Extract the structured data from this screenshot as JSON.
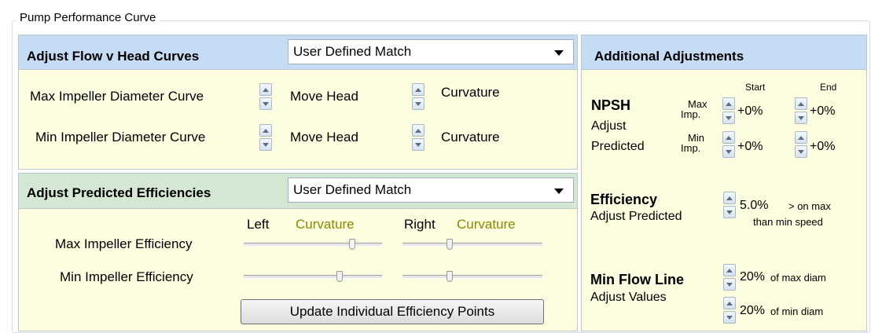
{
  "group_title": "Pump Performance Curve",
  "flow_head": {
    "title": "Adjust Flow v Head Curves",
    "mode": "User Defined Match",
    "rows": [
      {
        "label": "Max Impeller Diameter Curve",
        "move_label": "Move Head",
        "curv_label": "Curvature"
      },
      {
        "label": "Min Impeller Diameter Curve",
        "move_label": "Move Head",
        "curv_label": "Curvature"
      }
    ]
  },
  "efficiencies": {
    "title": "Adjust Predicted Efficiencies",
    "mode": "User Defined Match",
    "left_label": "Left",
    "left_sub": "Curvature",
    "right_label": "Right",
    "right_sub": "Curvature",
    "rows": [
      {
        "label": "Max Impeller Efficiency",
        "left_level": 0.8,
        "right_level": 0.33
      },
      {
        "label": "Min Impeller Efficiency",
        "left_level": 0.7,
        "right_level": 0.33
      }
    ],
    "update_button": "Update Individual Efficiency Points"
  },
  "additional": {
    "title": "Additional Adjustments",
    "npsh": {
      "title": "NPSH",
      "sub1": "Adjust",
      "sub2": "Predicted",
      "start_label": "Start",
      "end_label": "End",
      "max_label_1": "Max",
      "max_label_2": "Imp.",
      "min_label_1": "Min",
      "min_label_2": "Imp.",
      "max_start": "+0%",
      "max_end": "+0%",
      "min_start": "+0%",
      "min_end": "+0%"
    },
    "efficiency": {
      "title": "Efficiency",
      "sub": "Adjust Predicted",
      "value": "5.0%",
      "note1": "> on max",
      "note2": "than min speed"
    },
    "minflow": {
      "title": "Min Flow Line",
      "sub": "Adjust Values",
      "max_value": "20%",
      "max_note": "of max diam",
      "min_value": "20%",
      "min_note": "of min diam"
    }
  },
  "colors": {
    "panel_bg": "#fdfde0",
    "header_blue": "#c6dcf4",
    "header_green": "#d3e7d3",
    "curvature_text": "#8a8a00"
  }
}
